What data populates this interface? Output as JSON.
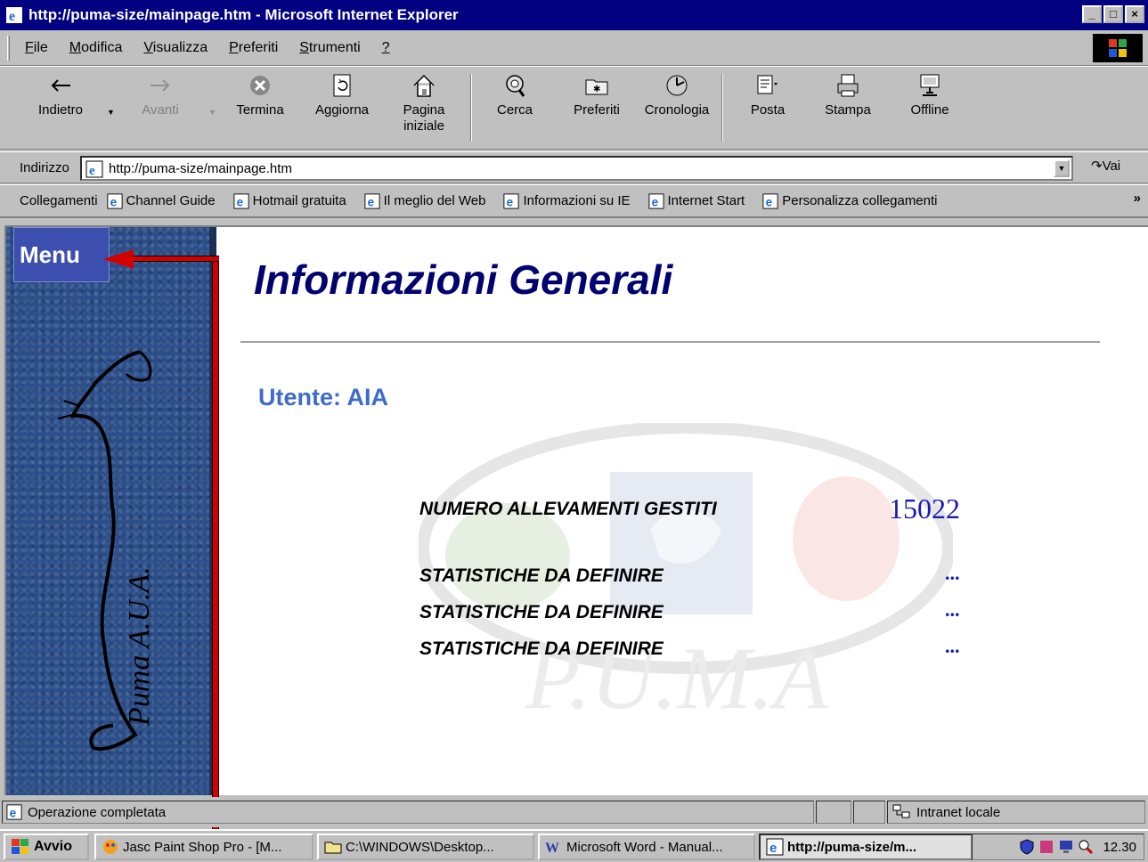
{
  "window": {
    "title": "http://puma-size/mainpage.htm - Microsoft Internet Explorer",
    "controls": [
      "_",
      "□",
      "×"
    ]
  },
  "menubar": {
    "items": [
      {
        "accel": "F",
        "rest": "ile"
      },
      {
        "accel": "M",
        "rest": "odifica"
      },
      {
        "accel": "V",
        "rest": "isualizza"
      },
      {
        "accel": "P",
        "rest": "referiti"
      },
      {
        "accel": "S",
        "rest": "trumenti"
      },
      {
        "accel": "?",
        "rest": ""
      }
    ]
  },
  "toolbar": {
    "buttons": [
      {
        "label": "Indietro",
        "icon": "back-arrow-icon"
      },
      {
        "label": "Avanti",
        "icon": "forward-arrow-icon"
      },
      {
        "label": "Termina",
        "icon": "stop-icon"
      },
      {
        "label": "Aggiorna",
        "icon": "refresh-icon"
      },
      {
        "label": "Pagina iniziale",
        "icon": "home-icon"
      },
      {
        "label": "Cerca",
        "icon": "search-icon"
      },
      {
        "label": "Preferiti",
        "icon": "favorites-icon"
      },
      {
        "label": "Cronologia",
        "icon": "history-icon"
      },
      {
        "label": "Posta",
        "icon": "mail-icon"
      },
      {
        "label": "Stampa",
        "icon": "print-icon"
      },
      {
        "label": "Offline",
        "icon": "offline-icon"
      }
    ]
  },
  "address": {
    "label": "Indirizzo",
    "url": "http://puma-size/mainpage.htm",
    "go": "Vai"
  },
  "links": {
    "label": "Collegamenti",
    "items": [
      "Channel Guide",
      "Hotmail gratuita",
      "Il meglio del Web",
      "Informazioni su IE",
      "Internet Start",
      "Personalizza collegamenti"
    ],
    "more": "»"
  },
  "page": {
    "menu_button": "Menu",
    "title": "Informazioni Generali",
    "user_line": "Utente: AIA",
    "stats": [
      {
        "label": "NUMERO ALLEVAMENTI GESTITI",
        "value": "15022"
      },
      {
        "label": "STATISTICHE DA DEFINIRE",
        "value": "..."
      },
      {
        "label": "STATISTICHE DA DEFINIRE",
        "value": "..."
      },
      {
        "label": "STATISTICHE DA DEFINIRE",
        "value": "..."
      }
    ],
    "sidebar_logo": "Puma A.U.A.",
    "watermark_text": "P.U.M.A"
  },
  "colors": {
    "title_blue": "#00006e",
    "user_blue": "#3f6bc9",
    "value_blue": "#1a1ab0",
    "annotation_red": "#d40000",
    "sidebar_blue": "#2c4f8a",
    "menu_button_bg": "#3c4fae"
  },
  "statusbar": {
    "text": "Operazione completata",
    "zone": "Intranet locale"
  },
  "taskbar": {
    "start": "Avvio",
    "tasks": [
      "Jasc Paint Shop Pro - [M...",
      "C:\\WINDOWS\\Desktop...",
      "Microsoft Word - Manual...",
      "http://puma-size/m..."
    ],
    "clock": "12.30"
  }
}
